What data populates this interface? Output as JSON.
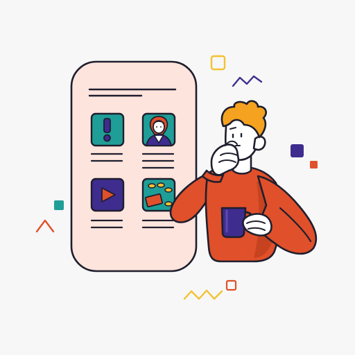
{
  "illustration": {
    "background": "#f7f7f7",
    "outline": "#1e1e2e",
    "colors": {
      "panel": "#fde4dc",
      "teal": "#1f9e97",
      "purple": "#3f2c8f",
      "orange": "#e0502a",
      "orange_dark": "#c7431f",
      "hair": "#f4a21f",
      "skin": "#ffffff",
      "sparkle_yellow": "#f2c230",
      "sparkle_orange": "#e0502a"
    },
    "panel": {
      "name": "app-card",
      "tiles": [
        {
          "name": "alert-tile",
          "icon": "exclamation-icon",
          "color": "#1f9e97"
        },
        {
          "name": "profile-tile",
          "icon": "person-avatar-icon",
          "color": "#1f9e97"
        },
        {
          "name": "video-tile",
          "icon": "play-icon",
          "color": "#3f2c8f"
        },
        {
          "name": "money-tile",
          "icon": "coins-cash-icon",
          "color": "#1f9e97"
        }
      ]
    },
    "character": {
      "name": "thinking-man",
      "holding": "mug-icon",
      "pose": "hand-on-chin"
    }
  }
}
